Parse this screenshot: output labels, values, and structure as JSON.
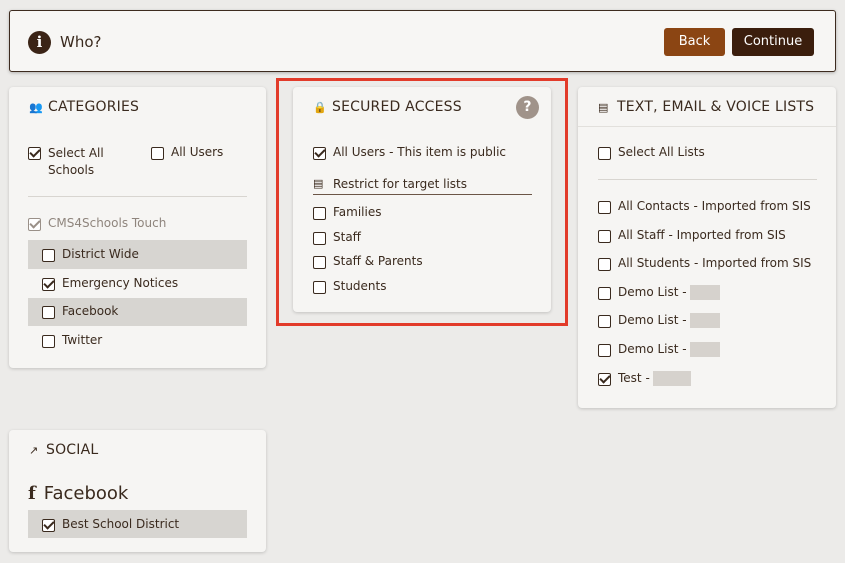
{
  "header": {
    "title": "Who?",
    "back_label": "Back",
    "continue_label": "Continue"
  },
  "categories": {
    "title": "CATEGORIES",
    "select_all_line1": "Select All",
    "select_all_line2": "Schools",
    "all_users": "All Users",
    "group_label": "CMS4Schools Touch",
    "items": [
      {
        "label": "District Wide",
        "checked": false
      },
      {
        "label": "Emergency Notices",
        "checked": true
      },
      {
        "label": "Facebook",
        "checked": false
      },
      {
        "label": "Twitter",
        "checked": false
      }
    ]
  },
  "secured": {
    "title": "SECURED ACCESS",
    "help": "?",
    "all_users": "All Users - This item is public",
    "restrict_label": "Restrict for target lists",
    "items": [
      {
        "label": "Families",
        "checked": false
      },
      {
        "label": "Staff",
        "checked": false
      },
      {
        "label": "Staff & Parents",
        "checked": false
      },
      {
        "label": "Students",
        "checked": false
      }
    ]
  },
  "lists": {
    "title": "TEXT, EMAIL & VOICE LISTS",
    "select_all": "Select All Lists",
    "items": [
      {
        "label": "All Contacts - Imported from SIS",
        "checked": false
      },
      {
        "label": "All Staff - Imported from SIS",
        "checked": false
      },
      {
        "label": "All Students - Imported from SIS",
        "checked": false
      },
      {
        "label": "Demo List -",
        "checked": false
      },
      {
        "label": "Demo List -",
        "checked": false
      },
      {
        "label": "Demo List -",
        "checked": false
      },
      {
        "label": "Test -",
        "checked": true
      }
    ]
  },
  "social": {
    "title": "SOCIAL",
    "network": "Facebook",
    "network_icon": "f",
    "accounts": [
      {
        "label": "Best School District",
        "checked": true
      }
    ]
  }
}
